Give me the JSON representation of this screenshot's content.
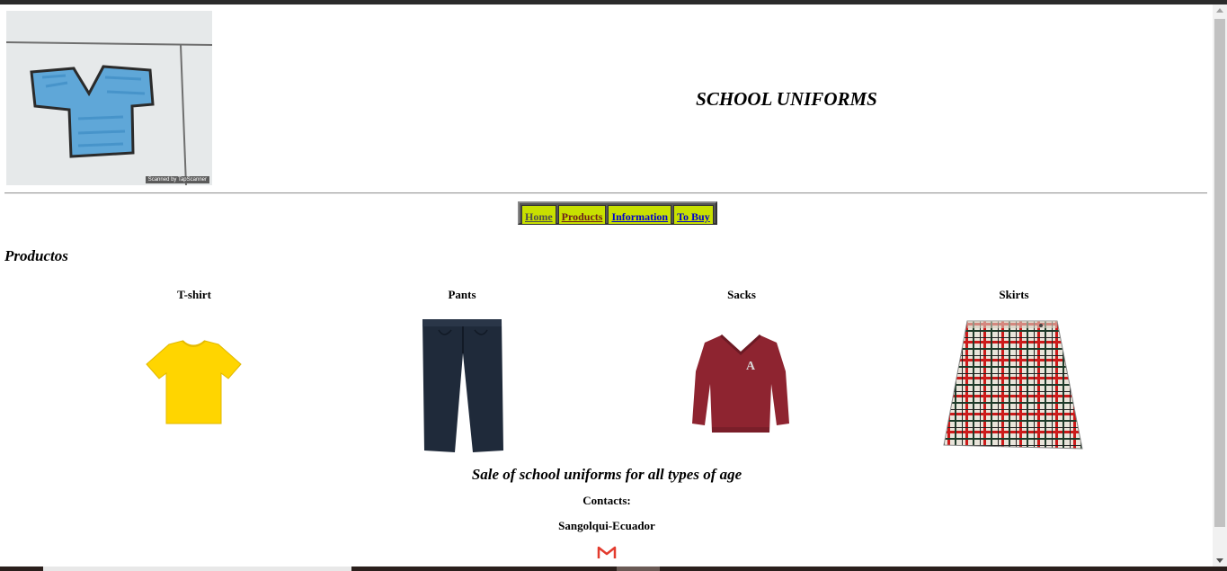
{
  "header": {
    "logo_caption": "Scanned by TapScanner",
    "title": "SCHOOL UNIFORMS"
  },
  "nav": {
    "items": [
      {
        "label": "Home"
      },
      {
        "label": "Products"
      },
      {
        "label": "Information"
      },
      {
        "label": "To Buy"
      }
    ]
  },
  "main": {
    "heading": "Productos",
    "products": [
      {
        "name": "T-shirt",
        "image": "yellow-tshirt"
      },
      {
        "name": "Pants",
        "image": "navy-pants"
      },
      {
        "name": "Sacks",
        "image": "maroon-sweater"
      },
      {
        "name": "Skirts",
        "image": "plaid-skirt"
      }
    ]
  },
  "footer": {
    "tagline": "Sale of school uniforms for all types of age",
    "contacts_label": "Contacts:",
    "location": "Sangolqui-Ecuador",
    "mail_icon": "gmail-icon"
  },
  "colors": {
    "nav_bg": "#c8e000",
    "nav_border": "#555555",
    "tshirt": "#ffd500",
    "pants": "#1f2a3a",
    "sweater": "#8e2430"
  }
}
